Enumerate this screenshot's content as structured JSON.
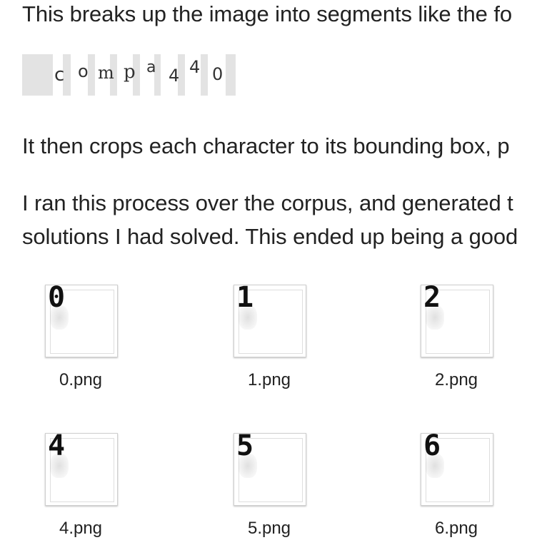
{
  "paragraphs": {
    "intro": "This breaks up the image into segments like the fo",
    "crop": "It then crops each character to its bounding box, p",
    "corpus_line1": "I ran this process over the corpus, and generated t",
    "corpus_line2": "solutions I had solved. This ended up being a good"
  },
  "segmented_captcha": {
    "characters": [
      "c",
      "o",
      "m",
      "p",
      "a",
      "4",
      "4",
      "0"
    ]
  },
  "thumbnails": [
    {
      "digit": "0",
      "filename": "0.png"
    },
    {
      "digit": "1",
      "filename": "1.png"
    },
    {
      "digit": "2",
      "filename": "2.png"
    },
    {
      "digit": "4",
      "filename": "4.png"
    },
    {
      "digit": "5",
      "filename": "5.png"
    },
    {
      "digit": "6",
      "filename": "6.png"
    }
  ]
}
